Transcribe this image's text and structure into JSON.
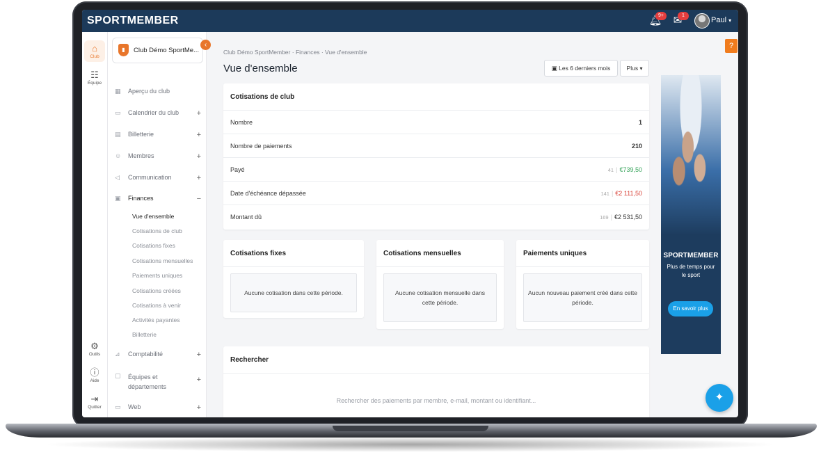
{
  "topbar": {
    "logo": "SPORTMEMBER",
    "notifications_badge": "9+",
    "messages_badge": "1",
    "user_name": "Paul"
  },
  "rail": {
    "items": [
      {
        "label": "Club",
        "icon": "club-icon"
      },
      {
        "label": "Équipe",
        "icon": "team-icon"
      },
      {
        "label": "Outils",
        "icon": "gear-icon"
      },
      {
        "label": "Aide",
        "icon": "help-circle-icon"
      },
      {
        "label": "Quitter",
        "icon": "logout-icon"
      }
    ]
  },
  "sidebar": {
    "club_name": "Club Démo SportMe...",
    "items": [
      {
        "label": "Aperçu du club"
      },
      {
        "label": "Calendrier du club",
        "expand": "+"
      },
      {
        "label": "Billetterie",
        "expand": "+"
      },
      {
        "label": "Membres",
        "expand": "+"
      },
      {
        "label": "Communication",
        "expand": "+"
      },
      {
        "label": "Finances",
        "expand": "−"
      },
      {
        "label": "Comptabilité",
        "expand": "+"
      },
      {
        "label": "Équipes et départements",
        "expand": "+"
      },
      {
        "label": "Web",
        "expand": "+"
      }
    ],
    "finance_sub": [
      "Vue d'ensemble",
      "Cotisations de club",
      "Cotisations fixes",
      "Cotisations mensuelles",
      "Paiements uniques",
      "Cotisations créées",
      "Cotisations à venir",
      "Activités payantes",
      "Billetterie"
    ]
  },
  "main": {
    "breadcrumb": [
      "Club Démo SportMember",
      "Finances",
      "Vue d'ensemble"
    ],
    "title": "Vue d'ensemble",
    "period_button": "Les 6 derniers mois",
    "more_button": "Plus",
    "club_fees": {
      "title": "Cotisations de club",
      "rows": [
        {
          "label": "Nombre",
          "value": "1"
        },
        {
          "label": "Nombre de paiements",
          "value": "210"
        },
        {
          "label": "Payé",
          "count": "41",
          "value": "€739,50"
        },
        {
          "label": "Date d'échéance dépassée",
          "count": "141",
          "value": "€2 111,50"
        },
        {
          "label": "Montant dû",
          "count": "169",
          "value": "€2 531,50"
        }
      ]
    },
    "cards": [
      {
        "title": "Cotisations fixes",
        "empty": "Aucune cotisation dans cette période."
      },
      {
        "title": "Cotisations mensuelles",
        "empty": "Aucune cotisation mensuelle dans cette période."
      },
      {
        "title": "Paiements uniques",
        "empty": "Aucun nouveau paiement créé dans cette période."
      }
    ],
    "search": {
      "title": "Rechercher",
      "placeholder": "Rechercher des paiements par membre, e-mail, montant ou identifiant..."
    }
  },
  "ad": {
    "logo": "SPORTMEMBER",
    "tagline": "Plus de temps pour le sport",
    "button": "En savoir plus"
  },
  "help_button": "?",
  "colors": {
    "topbar": "#1c3a5a",
    "accent": "#e8762b",
    "paid": "#3aa55d",
    "overdue": "#d9443a",
    "fab": "#1aa0e8"
  }
}
